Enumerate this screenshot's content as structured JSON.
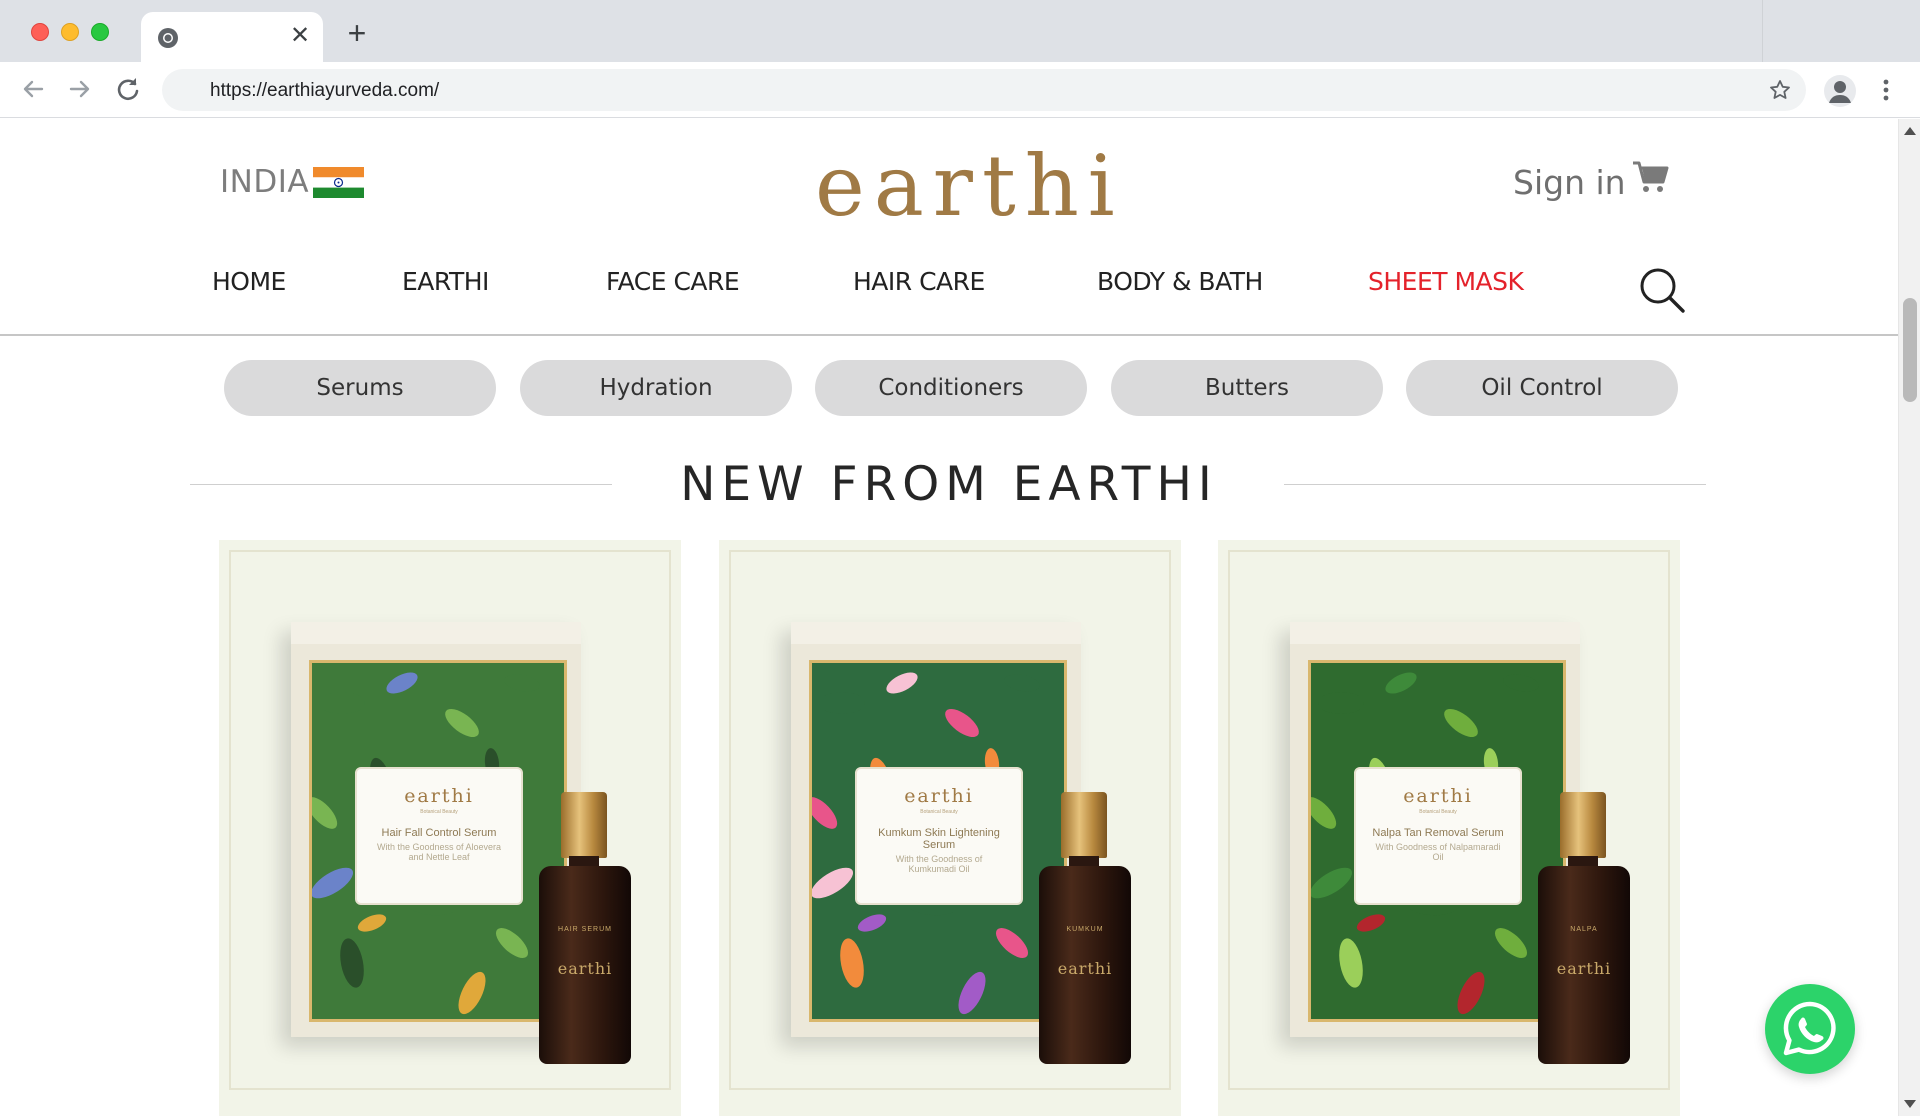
{
  "browser": {
    "tab_close": "✕",
    "new_tab": "+",
    "url": "https://earthiayurveda.com/"
  },
  "header": {
    "country": "INDIA",
    "logo": "earthi",
    "sign_in": "Sign in"
  },
  "nav": {
    "items": [
      {
        "label": "HOME"
      },
      {
        "label": "EARTHI"
      },
      {
        "label": "FACE CARE"
      },
      {
        "label": "HAIR CARE"
      },
      {
        "label": "BODY & BATH"
      },
      {
        "label": "SHEET MASK"
      }
    ],
    "highlight_color": "#e4222b"
  },
  "chips": [
    {
      "label": "Serums"
    },
    {
      "label": "Hydration"
    },
    {
      "label": "Conditioners"
    },
    {
      "label": "Butters"
    },
    {
      "label": "Oil Control"
    }
  ],
  "section": {
    "title": "NEW FROM EARTHI"
  },
  "products": [
    {
      "brand": "earthi",
      "tagline": "Botanical Beauty",
      "name": "Hair Fall Control Serum",
      "sub": "With the Goodness of Aloevera and Nettle Leaf",
      "bottle_label": "HAIR SERUM",
      "bottle_brand": "earthi",
      "art_colors": [
        "#3f7a3a",
        "#79b552",
        "#2a4f2a",
        "#e0a83a",
        "#6b83c9"
      ]
    },
    {
      "brand": "earthi",
      "tagline": "Botanical Beauty",
      "name": "Kumkum Skin Lightening Serum",
      "sub": "With the Goodness of Kumkumadi Oil",
      "bottle_label": "KUMKUM",
      "bottle_brand": "earthi",
      "art_colors": [
        "#2e6b3f",
        "#e8558a",
        "#f28b3c",
        "#a25bc7",
        "#f7c2d4"
      ]
    },
    {
      "brand": "earthi",
      "tagline": "Botanical Beauty",
      "name": "Nalpa Tan Removal Serum",
      "sub": "With Goodness of Nalpamaradi Oil",
      "bottle_label": "NALPA",
      "bottle_brand": "earthi",
      "art_colors": [
        "#2f6b2f",
        "#6fae3d",
        "#9bcf5a",
        "#b3262d",
        "#3e8a3a"
      ]
    }
  ],
  "colors": {
    "logo_gold": "#a07a45",
    "card_bg": "#f2f4e8",
    "chip_bg": "#dadadb",
    "whatsapp_green": "#2cd36a"
  }
}
